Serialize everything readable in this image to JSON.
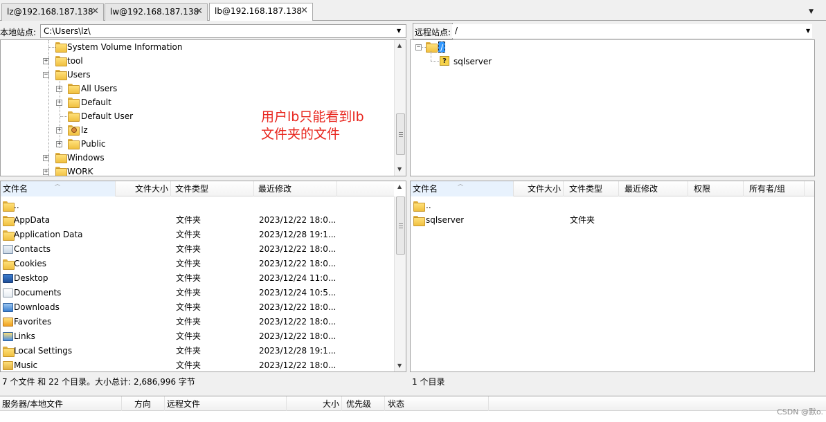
{
  "tabs": [
    {
      "label": "lz@192.168.187.138",
      "active": false
    },
    {
      "label": "lw@192.168.187.138",
      "active": false
    },
    {
      "label": "lb@192.168.187.138",
      "active": true
    }
  ],
  "local": {
    "site_label": "本地站点:",
    "path": "C:\\Users\\lz\\",
    "tree": [
      {
        "label": "System Volume Information",
        "expandable": false
      },
      {
        "label": "tool",
        "expandable": true,
        "expanded": false
      },
      {
        "label": "Users",
        "expandable": true,
        "expanded": true
      },
      {
        "label": "All Users",
        "expandable": true,
        "expanded": false
      },
      {
        "label": "Default",
        "expandable": true,
        "expanded": false
      },
      {
        "label": "Default User",
        "expandable": false
      },
      {
        "label": "lz",
        "expandable": true,
        "expanded": false,
        "icon": "user-folder-icon"
      },
      {
        "label": "Public",
        "expandable": true,
        "expanded": false
      },
      {
        "label": "Windows",
        "expandable": true,
        "expanded": false
      },
      {
        "label": "WORK",
        "expandable": true,
        "expanded": false
      }
    ],
    "columns": [
      "文件名",
      "文件大小",
      "文件类型",
      "最近修改"
    ],
    "files": [
      {
        "name": "..",
        "size": "",
        "type": "",
        "modified": "",
        "icon": "folder-icon"
      },
      {
        "name": "AppData",
        "size": "",
        "type": "文件夹",
        "modified": "2023/12/22 18:0...",
        "icon": "folder-icon"
      },
      {
        "name": "Application Data",
        "size": "",
        "type": "文件夹",
        "modified": "2023/12/28 19:1...",
        "icon": "folder-icon"
      },
      {
        "name": "Contacts",
        "size": "",
        "type": "文件夹",
        "modified": "2023/12/22 18:0...",
        "icon": "contacts-icon"
      },
      {
        "name": "Cookies",
        "size": "",
        "type": "文件夹",
        "modified": "2023/12/22 18:0...",
        "icon": "folder-icon"
      },
      {
        "name": "Desktop",
        "size": "",
        "type": "文件夹",
        "modified": "2023/12/24 11:0...",
        "icon": "desktop-icon"
      },
      {
        "name": "Documents",
        "size": "",
        "type": "文件夹",
        "modified": "2023/12/24 10:5...",
        "icon": "documents-icon"
      },
      {
        "name": "Downloads",
        "size": "",
        "type": "文件夹",
        "modified": "2023/12/22 18:0...",
        "icon": "downloads-icon"
      },
      {
        "name": "Favorites",
        "size": "",
        "type": "文件夹",
        "modified": "2023/12/22 18:0...",
        "icon": "favorites-icon"
      },
      {
        "name": "Links",
        "size": "",
        "type": "文件夹",
        "modified": "2023/12/22 18:0...",
        "icon": "links-icon"
      },
      {
        "name": "Local Settings",
        "size": "",
        "type": "文件夹",
        "modified": "2023/12/28 19:1...",
        "icon": "folder-icon"
      },
      {
        "name": "Music",
        "size": "",
        "type": "文件夹",
        "modified": "2023/12/22 18:0...",
        "icon": "music-icon"
      }
    ],
    "status": "7 个文件 和 22 个目录。大小总计: 2,686,996 字节"
  },
  "remote": {
    "site_label": "远程站点:",
    "path": "/",
    "tree": [
      {
        "label": "/",
        "selected": true
      },
      {
        "label": "sqlserver",
        "icon": "unknown-folder-icon"
      }
    ],
    "columns": [
      "文件名",
      "文件大小",
      "文件类型",
      "最近修改",
      "权限",
      "所有者/组"
    ],
    "files": [
      {
        "name": "..",
        "size": "",
        "type": "",
        "modified": "",
        "perms": "",
        "owner": ""
      },
      {
        "name": "sqlserver",
        "size": "",
        "type": "文件夹",
        "modified": "",
        "perms": "",
        "owner": ""
      }
    ],
    "status": "1 个目录"
  },
  "annotation": {
    "line1": "用户lb只能看到lb",
    "line2": "文件夹的文件"
  },
  "queue": {
    "columns": [
      "服务器/本地文件",
      "方向",
      "远程文件",
      "大小",
      "优先级",
      "状态"
    ]
  },
  "watermark": "CSDN @默o.",
  "colors": {
    "annotation": "#e8261e",
    "selection": "#3399ff"
  }
}
